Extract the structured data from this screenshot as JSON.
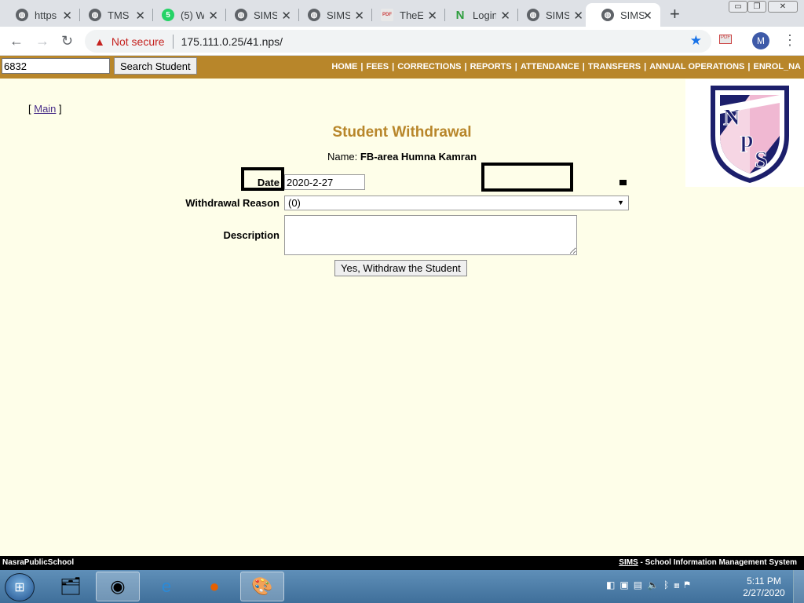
{
  "browser": {
    "tabs": [
      {
        "title": "https",
        "favicon": "globe-icon",
        "active": false
      },
      {
        "title": "TMS",
        "favicon": "globe-icon",
        "active": false
      },
      {
        "title": "(5) W",
        "favicon": "whatsapp-icon",
        "active": false
      },
      {
        "title": "SIMS",
        "favicon": "globe-icon",
        "active": false
      },
      {
        "title": "SIMS",
        "favicon": "globe-icon",
        "active": false
      },
      {
        "title": "TheE",
        "favicon": "pdf-icon",
        "active": false
      },
      {
        "title": "Login",
        "favicon": "n-logo-icon",
        "active": false
      },
      {
        "title": "SIMS",
        "favicon": "globe-icon",
        "active": false
      },
      {
        "title": "SIMS",
        "favicon": "globe-icon",
        "active": true
      }
    ],
    "security_label": "Not secure",
    "url": "175.111.0.25/41.nps/",
    "profile_initial": "M",
    "accent_color": "#1a73e8"
  },
  "header": {
    "search_value": "6832",
    "search_button": "Search Student",
    "nav": [
      "HOME",
      "FEES",
      "CORRECTIONS",
      "REPORTS",
      "ATTENDANCE",
      "TRANSFERS",
      "ANNUAL OPERATIONS",
      "ENROL_NA"
    ],
    "bar_color": "#b8862a"
  },
  "page": {
    "main_link": "Main",
    "title": "Student Withdrawal",
    "name_label": "Name:",
    "student_name": "FB-area Humna Kamran",
    "date_label": "Date",
    "date_value": "2020-2-27",
    "reason_label": "Withdrawal Reason",
    "reason_value": "(0)",
    "description_label": "Description",
    "description_value": "",
    "submit_button": "Yes, Withdraw the Student",
    "logo_letters": "NPS"
  },
  "footer": {
    "school": "NasraPublicSchool",
    "sims": "SIMS",
    "system_name": "- School Information Management System"
  },
  "taskbar": {
    "time": "5:11 PM",
    "date": "2/27/2020"
  }
}
